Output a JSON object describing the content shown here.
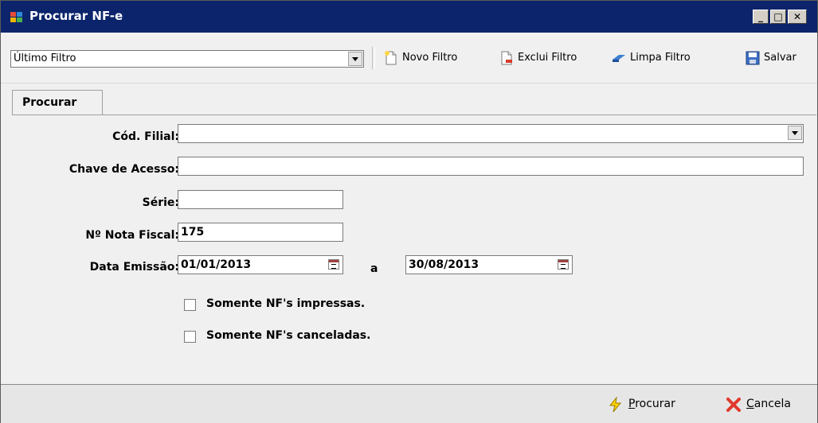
{
  "window": {
    "title": "Procurar NF-e"
  },
  "toolbar": {
    "filter_combo_value": "Último Filtro",
    "novo_filtro": "Novo Filtro",
    "exclui_filtro": "Exclui Filtro",
    "limpa_filtro": "Limpa Filtro",
    "salvar": "Salvar"
  },
  "tabs": [
    {
      "label": "Procurar"
    }
  ],
  "form": {
    "cod_filial_label": "Cód. Filial:",
    "cod_filial_value": "",
    "chave_label": "Chave de Acesso:",
    "chave_value": "",
    "serie_label": "Série:",
    "serie_value": "",
    "nota_label": "Nº Nota Fiscal:",
    "nota_value": "175",
    "data_label": "Data Emissão:",
    "data_inicio": "01/01/2013",
    "data_sep": "a",
    "data_fim": "30/08/2013",
    "somente_impressas": "Somente NF's impressas.",
    "somente_canceladas": "Somente NF's canceladas."
  },
  "footer": {
    "procurar": "Procurar",
    "cancela": "Cancela"
  }
}
